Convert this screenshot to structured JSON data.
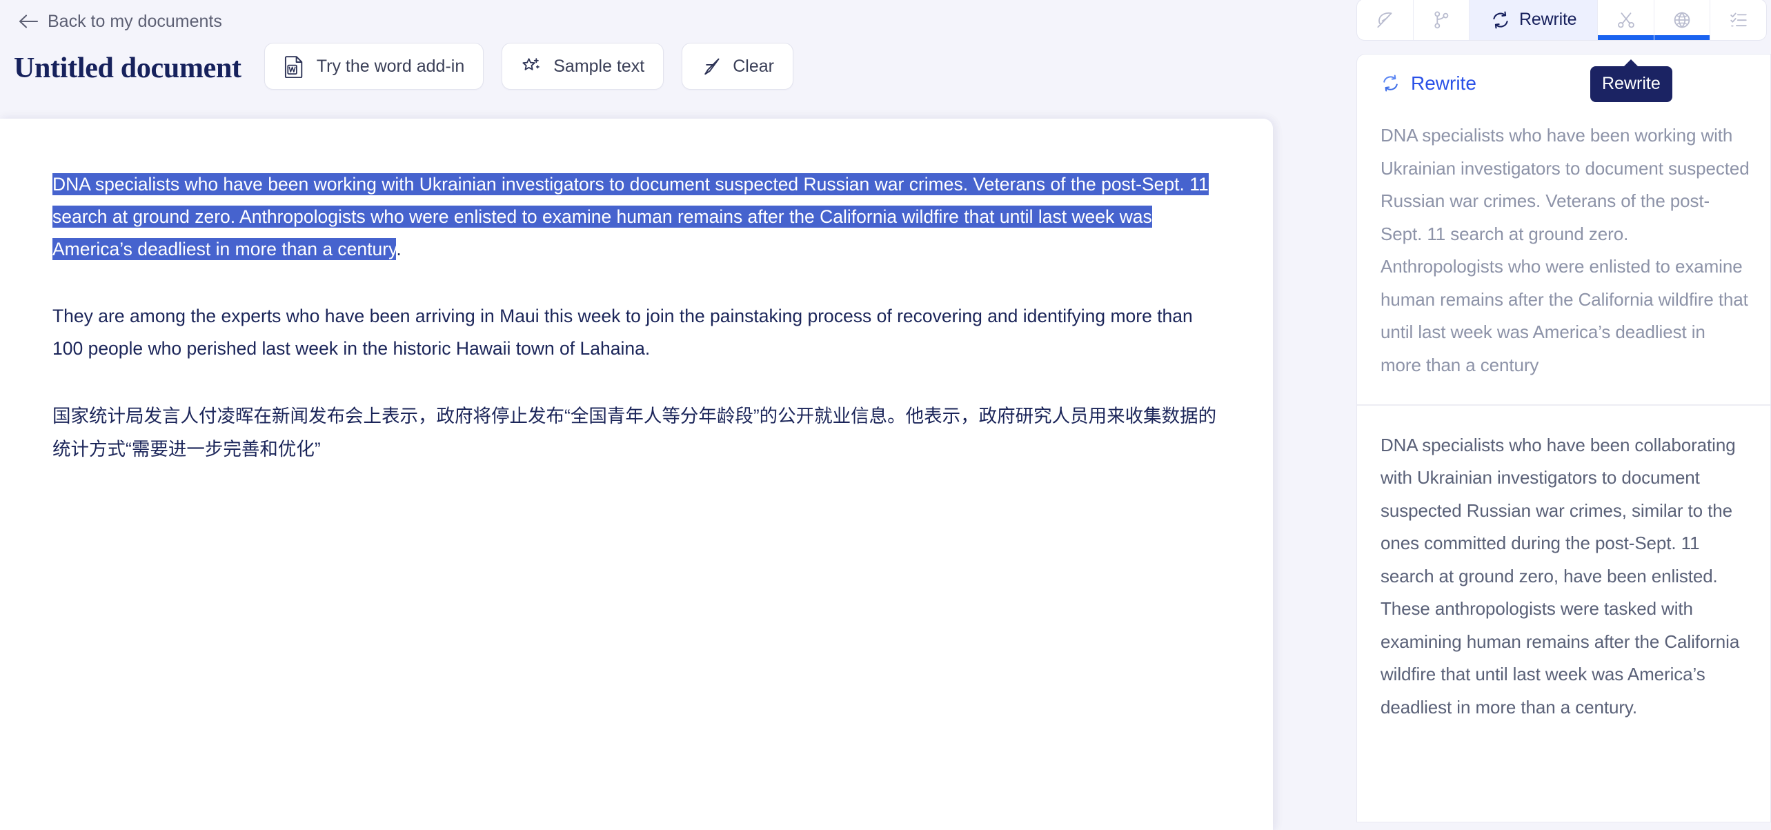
{
  "colors": {
    "page_background": "#f4f4fb",
    "paper": "#ffffff",
    "accent_blue": "#2a51e8",
    "tab_underline": "#1a63f0",
    "selection_blue": "#4663ce",
    "title_navy": "#16215c",
    "tooltip_navy": "#1b2363",
    "body_text": "#1b2559",
    "muted_text": "#8d93a8"
  },
  "header": {
    "back_label": "Back to my documents",
    "back_icon": "arrow-left-icon",
    "document_title": "Untitled document"
  },
  "toolbar": {
    "buttons": [
      {
        "label": "Try the word add-in",
        "icon": "word-document-icon"
      },
      {
        "label": "Sample text",
        "icon": "sparkle-star-icon"
      },
      {
        "label": "Clear",
        "icon": "magic-wand-icon"
      }
    ]
  },
  "document": {
    "paragraphs": [
      {
        "id": "p1",
        "selected_text": "DNA specialists who have been working with Ukrainian investigators to document suspected Russian war crimes. Veterans of the post-Sept. 11 search at ground zero. Anthropologists who were enlisted to examine human remains after the California wildfire that until last week was America’s deadliest in more than a century",
        "trailing_text": "."
      },
      {
        "id": "p2",
        "text": "They are among the experts who have been arriving in Maui this week to join the painstaking process of recovering and identifying more than 100 people who perished last week in the historic Hawaii town of Lahaina."
      },
      {
        "id": "p3",
        "text": "国家统计局发言人付凌晖在新闻发布会上表示，政府将停止发布“全国青年人等分年龄段”的公开就业信息。他表示，政府研究人员用来收集数据的统计方式“需要进一步完善和优化”"
      }
    ]
  },
  "right_panel": {
    "tabs": [
      {
        "id": "paraphrase",
        "icon": "feather-quill-icon",
        "label": "",
        "active": false,
        "underline": false
      },
      {
        "id": "flow",
        "icon": "git-branch-icon",
        "label": "",
        "active": false,
        "underline": false
      },
      {
        "id": "rewrite",
        "icon": "refresh-rewrite-icon",
        "label": "Rewrite",
        "active": true,
        "underline": false
      },
      {
        "id": "shorten",
        "icon": "scissors-icon",
        "label": "",
        "active": false,
        "underline": true
      },
      {
        "id": "translate",
        "icon": "globe-icon",
        "label": "",
        "active": false,
        "underline": true
      },
      {
        "id": "checklist",
        "icon": "checklist-icon",
        "label": "",
        "active": false,
        "underline": false
      }
    ],
    "tooltip": {
      "text": "Rewrite",
      "target_tab": "rewrite"
    },
    "panel_header": {
      "icon": "refresh-rewrite-icon",
      "label": "Rewrite"
    },
    "results": [
      {
        "id": "original",
        "emphasis": "muted",
        "text": "DNA specialists who have been working with Ukrainian investigators to document suspected Russian war crimes. Veterans of the post-Sept. 11 search at ground zero. Anthropologists who were enlisted to examine human remains after the California wildfire that until last week was America’s deadliest in more than a century"
      },
      {
        "id": "suggestion-1",
        "emphasis": "strong",
        "text": "DNA specialists who have been collaborating with Ukrainian investigators to document suspected Russian war crimes, similar to the ones committed during the post-Sept. 11 search at ground zero, have been enlisted. These anthropologists were tasked with examining human remains after the California wildfire that until last week was America’s deadliest in more than a century."
      }
    ]
  }
}
